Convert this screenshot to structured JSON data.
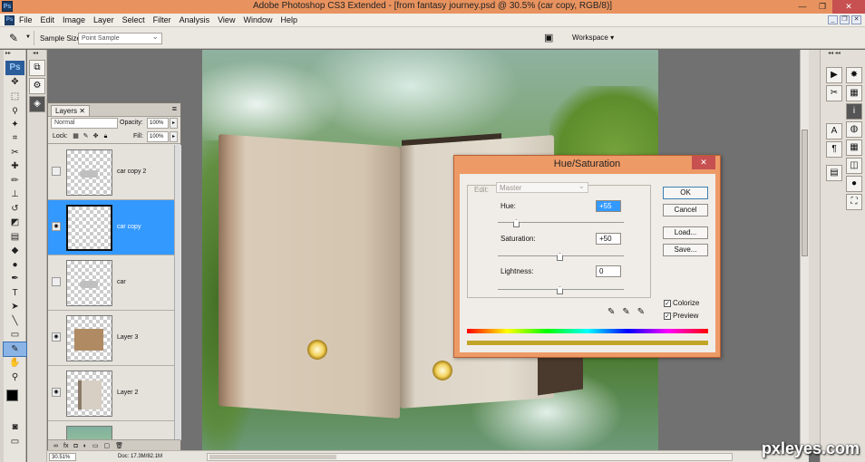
{
  "app": {
    "window_title": "Adobe Photoshop CS3 Extended - [from fantasy journey.psd @ 30.5% (car copy, RGB/8)]",
    "ps_icon": "Ps"
  },
  "menu": [
    "File",
    "Edit",
    "Image",
    "Layer",
    "Select",
    "Filter",
    "Analysis",
    "View",
    "Window",
    "Help"
  ],
  "options_bar": {
    "sample_size_label": "Sample Size:",
    "sample_size_value": "Point Sample",
    "workspace_label": "Workspace ▾"
  },
  "layers_panel": {
    "tab_label": "Layers",
    "blend_mode": "Normal",
    "opacity_label": "Opacity:",
    "opacity_value": "100%",
    "lock_label": "Lock:",
    "fill_label": "Fill:",
    "fill_value": "100%",
    "layers": [
      {
        "name": "car copy 2",
        "visible": false,
        "selected": false
      },
      {
        "name": "car copy",
        "visible": true,
        "selected": true
      },
      {
        "name": "car",
        "visible": false,
        "selected": false
      },
      {
        "name": "Layer 3",
        "visible": true,
        "selected": false
      },
      {
        "name": "Layer 2",
        "visible": true,
        "selected": false
      }
    ]
  },
  "status_bar": {
    "zoom": "30.51%",
    "doc": "Doc: 17.3M/82.1M"
  },
  "hue_saturation": {
    "title": "Hue/Saturation",
    "edit_label": "Edit:",
    "edit_value": "Master",
    "hue_label": "Hue:",
    "hue_value": "+55",
    "saturation_label": "Saturation:",
    "saturation_value": "+50",
    "lightness_label": "Lightness:",
    "lightness_value": "0",
    "ok_label": "OK",
    "cancel_label": "Cancel",
    "load_label": "Load...",
    "save_label": "Save...",
    "colorize_label": "Colorize",
    "colorize_checked": true,
    "preview_label": "Preview",
    "preview_checked": true,
    "colorized_bar_color": "#c2a528"
  },
  "watermark": "pxleyes.com"
}
